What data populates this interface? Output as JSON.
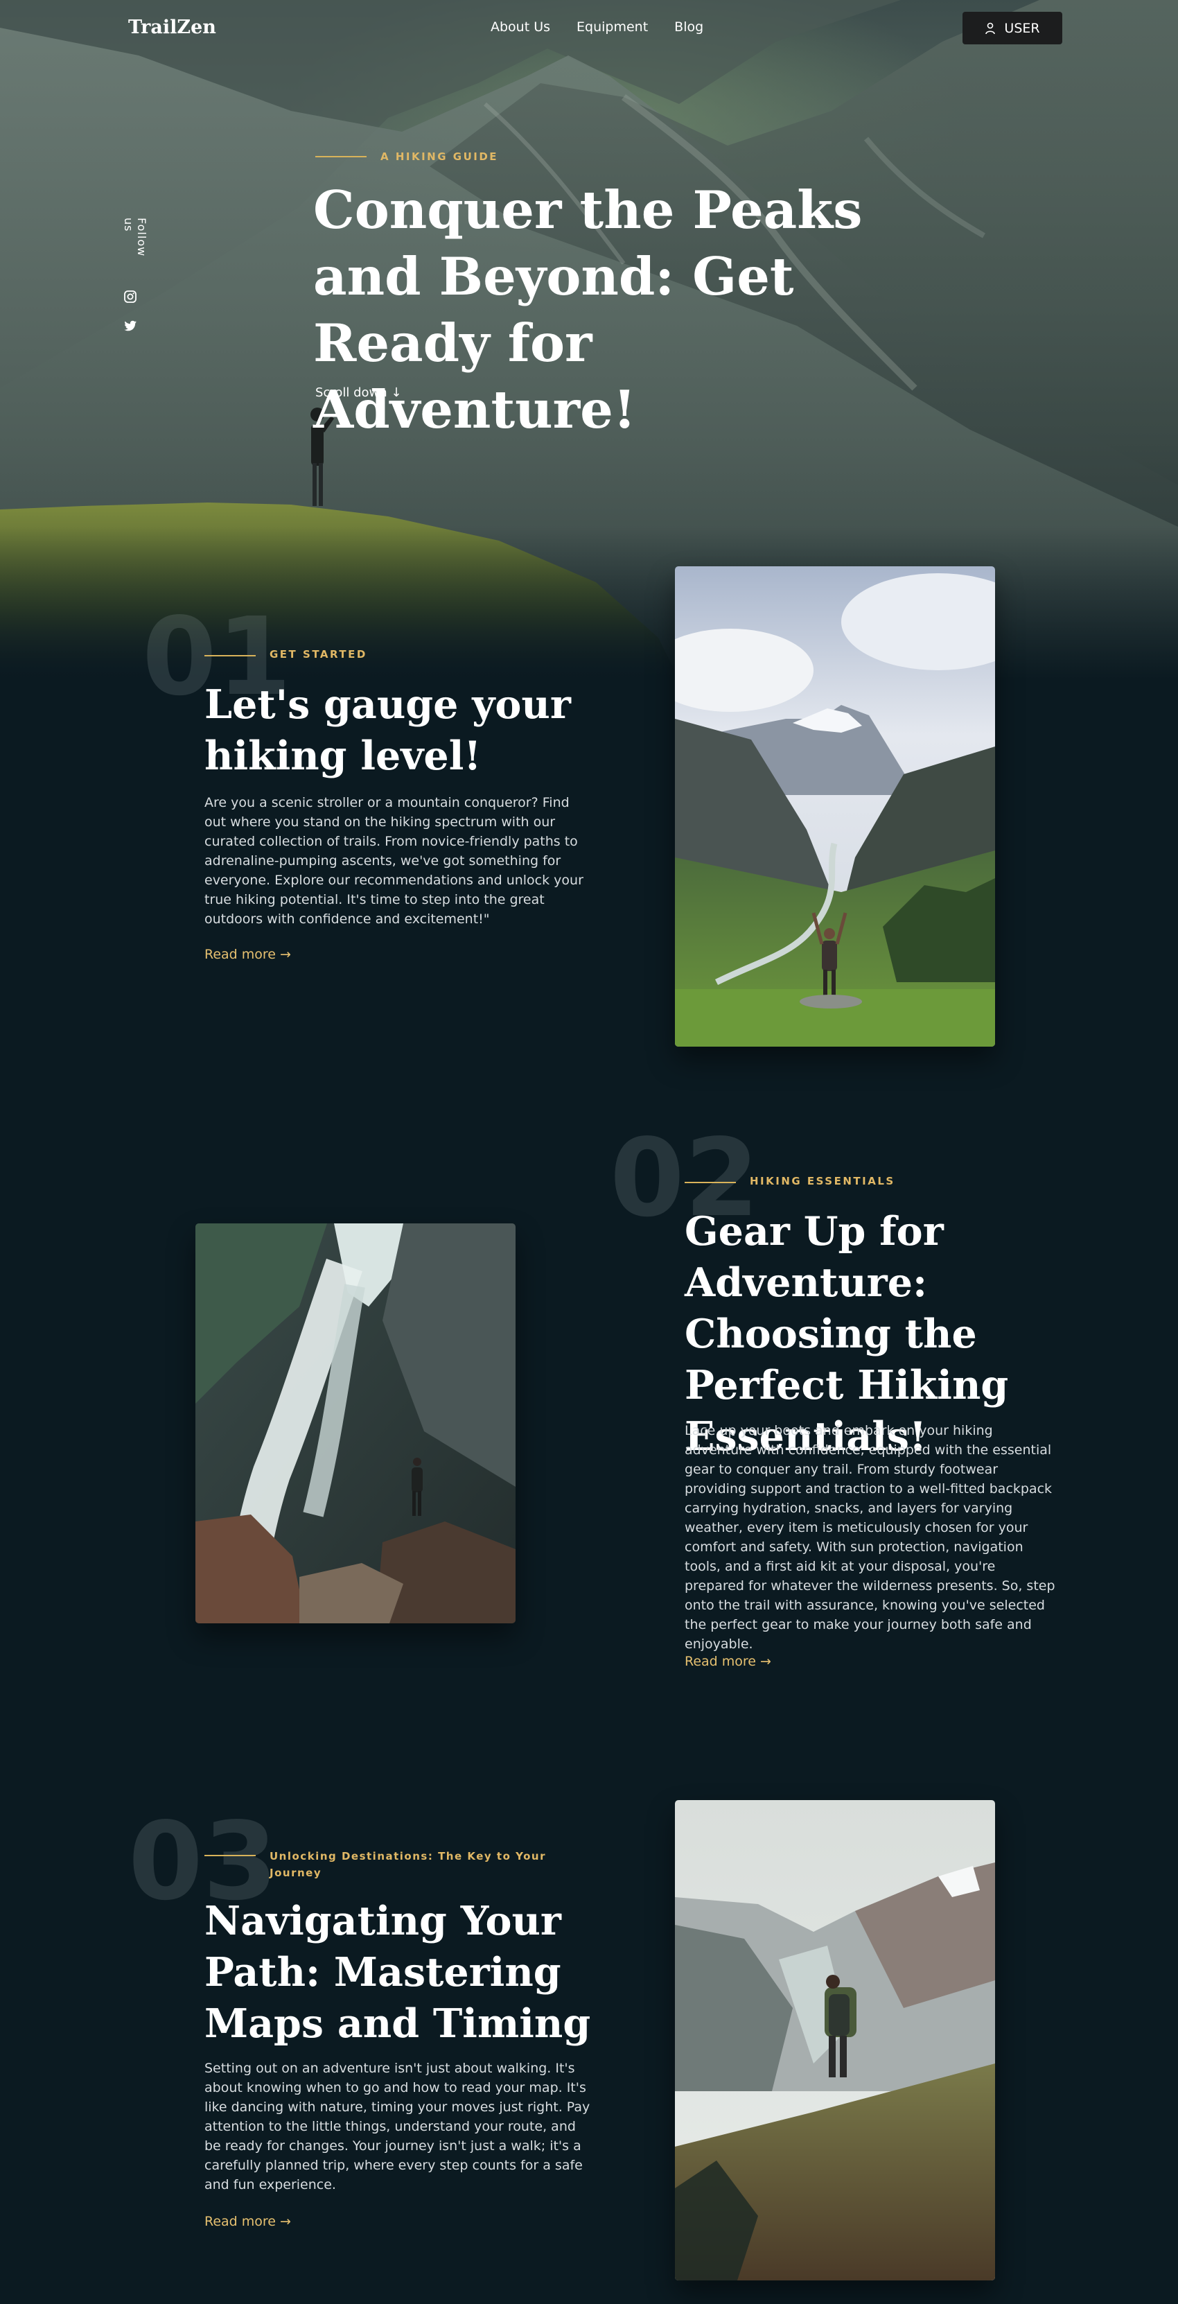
{
  "nav": {
    "logo": "TrailZen",
    "links": [
      "About Us",
      "Equipment",
      "Blog"
    ],
    "user_label": "USER"
  },
  "hero": {
    "eyebrow": "A HIKING GUIDE",
    "title": "Conquer the Peaks and Beyond: Get Ready for Adventure!",
    "scroll_label": "Scroll down ↓",
    "follow_label": "Follow us"
  },
  "sections": [
    {
      "number": "01",
      "eyebrow": "GET STARTED",
      "title": "Let's gauge your hiking level!",
      "body": "Are you a scenic stroller or a mountain conqueror? Find out where you stand on the hiking spectrum with our curated collection of trails. From novice-friendly paths to adrenaline-pumping ascents, we've got something for everyone. Explore our recommendations and unlock your true hiking potential. It's time to step into the great outdoors with confidence and excitement!\"",
      "read_more": "Read more →"
    },
    {
      "number": "02",
      "eyebrow": "HIKING ESSENTIALS",
      "title": "Gear Up for Adventure: Choosing the Perfect Hiking Essentials!",
      "body": "Lace up your boots and embark on your hiking adventure with confidence, equipped with the essential gear to conquer any trail. From sturdy footwear providing support and traction to a well-fitted backpack carrying hydration, snacks, and layers for varying weather, every item is meticulously chosen for your comfort and safety. With sun protection, navigation tools, and a first aid kit at your disposal, you're prepared for whatever the wilderness presents. So, step onto the trail with assurance, knowing you've selected the perfect gear to make your journey both safe and enjoyable.",
      "read_more": "Read more →"
    },
    {
      "number": "03",
      "eyebrow": "Unlocking Destinations: The Key to Your Journey",
      "title": "Navigating Your Path: Mastering Maps and Timing",
      "body": "Setting out on an adventure isn't just about walking. It's about knowing when to go and how to read your map. It's like dancing with nature, timing your moves just right. Pay attention to the little things, understand your route, and be ready for changes. Your journey isn't just a walk; it's a carefully planned trip, where every step counts for a safe and fun experience.",
      "read_more": "Read more →"
    }
  ],
  "colors": {
    "background": "#0b1a21",
    "accent": "#e1b865",
    "button": "#1c1d1e"
  },
  "icons": [
    "user-icon",
    "instagram-icon",
    "twitter-icon",
    "arrow-right-icon",
    "arrow-down-icon"
  ]
}
